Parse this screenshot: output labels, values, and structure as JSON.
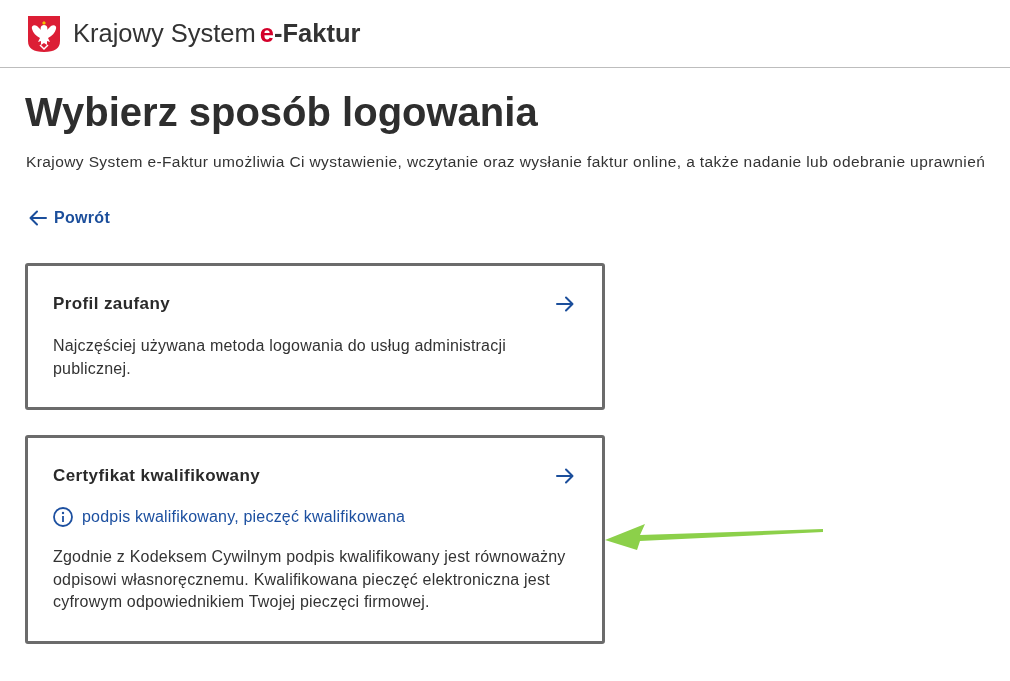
{
  "header": {
    "title": "Krajowy System",
    "brand_accent": "e",
    "brand_rest": "-Faktur"
  },
  "heading": "Wybierz sposób logowania",
  "intro": "Krajowy System e-Faktur umożliwia Ci wystawienie, wczytanie oraz wysłanie faktur online, a także nadanie lub odebranie uprawnień",
  "back_link": {
    "label": "Powrót"
  },
  "login_options": [
    {
      "title": "Profil zaufany",
      "description": "Najczęściej używana metoda logowania do usług administracji publicznej."
    },
    {
      "title": "Certyfikat kwalifikowany",
      "info": "podpis kwalifikowany, pieczęć kwalifikowana",
      "description": "Zgodnie z Kodeksem Cywilnym podpis kwalifikowany jest równoważny odpisowi własnoręcznemu. Kwalifikowana pieczęć elektroniczna jest cyfrowym odpowiednikiem Twojej pieczęci firmowej."
    }
  ]
}
